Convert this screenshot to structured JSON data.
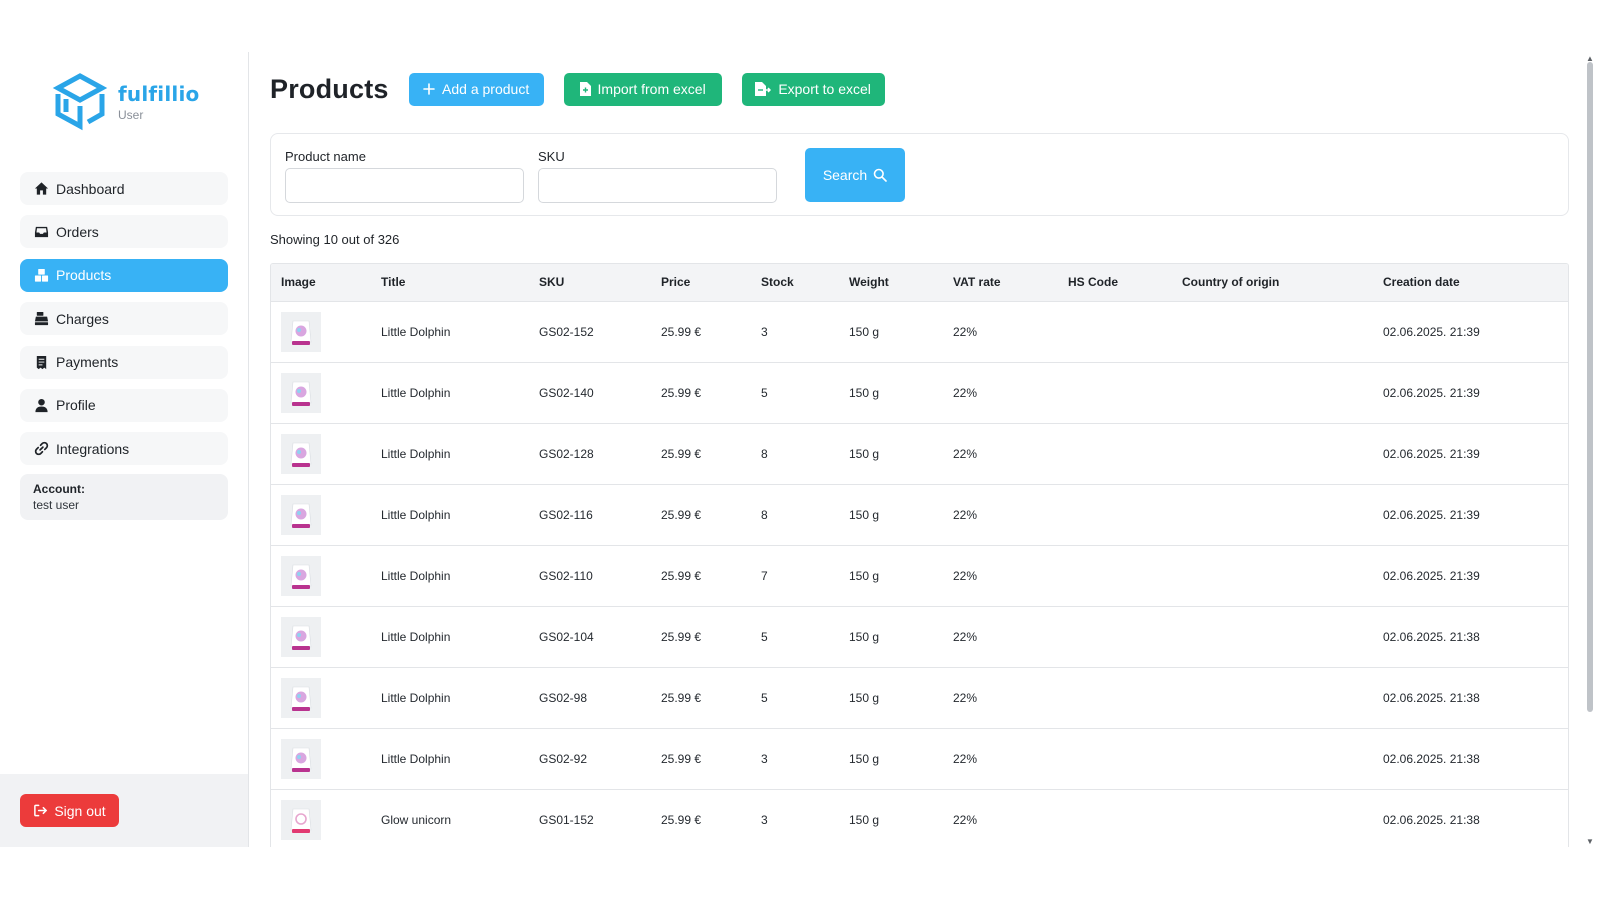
{
  "brand": {
    "name": "fulfillio",
    "role": "User",
    "accent": "#38b2f5",
    "green": "#1fb67a",
    "danger": "#ec3b3b"
  },
  "sidebar": {
    "items": [
      {
        "label": "Dashboard",
        "icon": "home-icon",
        "active": false
      },
      {
        "label": "Orders",
        "icon": "inbox-icon",
        "active": false
      },
      {
        "label": "Products",
        "icon": "boxes-icon",
        "active": true
      },
      {
        "label": "Charges",
        "icon": "cash-register-icon",
        "active": false
      },
      {
        "label": "Payments",
        "icon": "receipt-icon",
        "active": false
      },
      {
        "label": "Profile",
        "icon": "user-icon",
        "active": false
      },
      {
        "label": "Integrations",
        "icon": "link-icon",
        "active": false
      }
    ],
    "account_label": "Account:",
    "account_user": "test user",
    "signout_label": "Sign out"
  },
  "header": {
    "title": "Products",
    "add_label": "Add a product",
    "import_label": "Import from excel",
    "export_label": "Export to excel"
  },
  "filters": {
    "product_name_label": "Product name",
    "product_name_value": "",
    "sku_label": "SKU",
    "sku_value": "",
    "search_label": "Search"
  },
  "showing": "Showing 10 out of 326",
  "table": {
    "columns": [
      "Image",
      "Title",
      "SKU",
      "Price",
      "Stock",
      "Weight",
      "VAT rate",
      "HS Code",
      "Country of origin",
      "Creation date"
    ],
    "rows": [
      {
        "title": "Little Dolphin",
        "sku": "GS02-152",
        "price": "25.99 €",
        "stock": "3",
        "weight": "150 g",
        "vat": "22%",
        "hs": "",
        "country": "",
        "created": "02.06.2025. 21:39"
      },
      {
        "title": "Little Dolphin",
        "sku": "GS02-140",
        "price": "25.99 €",
        "stock": "5",
        "weight": "150 g",
        "vat": "22%",
        "hs": "",
        "country": "",
        "created": "02.06.2025. 21:39"
      },
      {
        "title": "Little Dolphin",
        "sku": "GS02-128",
        "price": "25.99 €",
        "stock": "8",
        "weight": "150 g",
        "vat": "22%",
        "hs": "",
        "country": "",
        "created": "02.06.2025. 21:39"
      },
      {
        "title": "Little Dolphin",
        "sku": "GS02-116",
        "price": "25.99 €",
        "stock": "8",
        "weight": "150 g",
        "vat": "22%",
        "hs": "",
        "country": "",
        "created": "02.06.2025. 21:39"
      },
      {
        "title": "Little Dolphin",
        "sku": "GS02-110",
        "price": "25.99 €",
        "stock": "7",
        "weight": "150 g",
        "vat": "22%",
        "hs": "",
        "country": "",
        "created": "02.06.2025. 21:39"
      },
      {
        "title": "Little Dolphin",
        "sku": "GS02-104",
        "price": "25.99 €",
        "stock": "5",
        "weight": "150 g",
        "vat": "22%",
        "hs": "",
        "country": "",
        "created": "02.06.2025. 21:38"
      },
      {
        "title": "Little Dolphin",
        "sku": "GS02-98",
        "price": "25.99 €",
        "stock": "5",
        "weight": "150 g",
        "vat": "22%",
        "hs": "",
        "country": "",
        "created": "02.06.2025. 21:38"
      },
      {
        "title": "Little Dolphin",
        "sku": "GS02-92",
        "price": "25.99 €",
        "stock": "3",
        "weight": "150 g",
        "vat": "22%",
        "hs": "",
        "country": "",
        "created": "02.06.2025. 21:38"
      },
      {
        "title": "Glow unicorn",
        "sku": "GS01-152",
        "price": "25.99 €",
        "stock": "3",
        "weight": "150 g",
        "vat": "22%",
        "hs": "",
        "country": "",
        "created": "02.06.2025. 21:38"
      }
    ]
  }
}
